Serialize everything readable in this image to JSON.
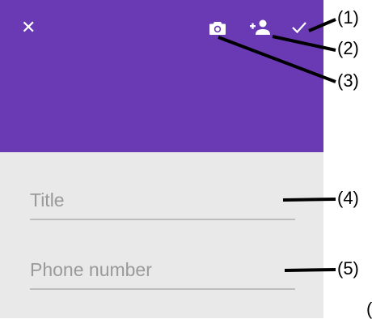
{
  "toolbar": {
    "close_icon": "close-icon",
    "camera_icon": "camera-icon",
    "add_person_icon": "add-person-icon",
    "check_icon": "check-icon",
    "close_glyph": "✕",
    "color": "#6a3ab5"
  },
  "form": {
    "title_placeholder": "Title",
    "phone_placeholder": "Phone number",
    "background": "#e9e9e9"
  },
  "callouts": [
    "(1)",
    "(2)",
    "(3)",
    "(4)",
    "(5)",
    "("
  ]
}
